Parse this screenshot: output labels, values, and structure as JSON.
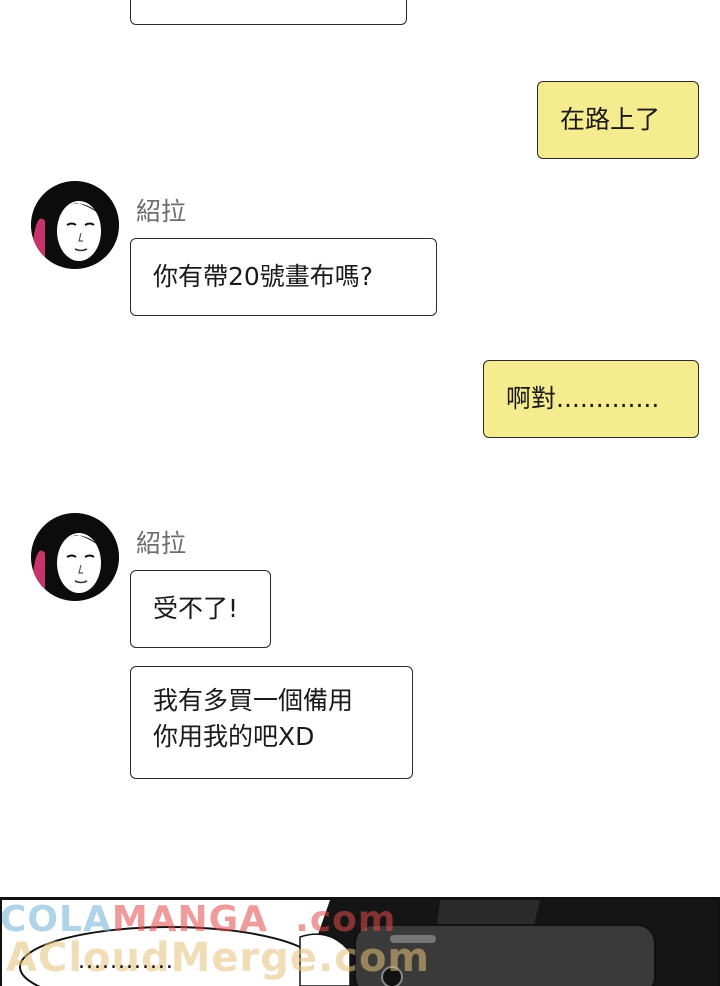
{
  "messages": [
    {
      "type": "sent",
      "text": "在路上了"
    },
    {
      "type": "received",
      "sender": "紹拉",
      "text": "你有帶20號畫布嗎?"
    },
    {
      "type": "sent",
      "text": "啊對............."
    },
    {
      "type": "received",
      "sender": "紹拉",
      "lines": [
        "受不了!",
        "我有多買一個備用",
        "你用我的吧XD"
      ]
    }
  ],
  "bottom_panel": {
    "speech_text": "............",
    "watermark_line1_a": "COLA",
    "watermark_line1_b": "MANGA",
    "watermark_line1_c": ".com",
    "watermark_line2": "ACloudMerge.com"
  },
  "colors": {
    "sent_bubble": "#f5eb8f",
    "received_bubble": "#ffffff",
    "sender_name": "#6e6e6e"
  },
  "icons": [
    "avatar-portrait"
  ]
}
